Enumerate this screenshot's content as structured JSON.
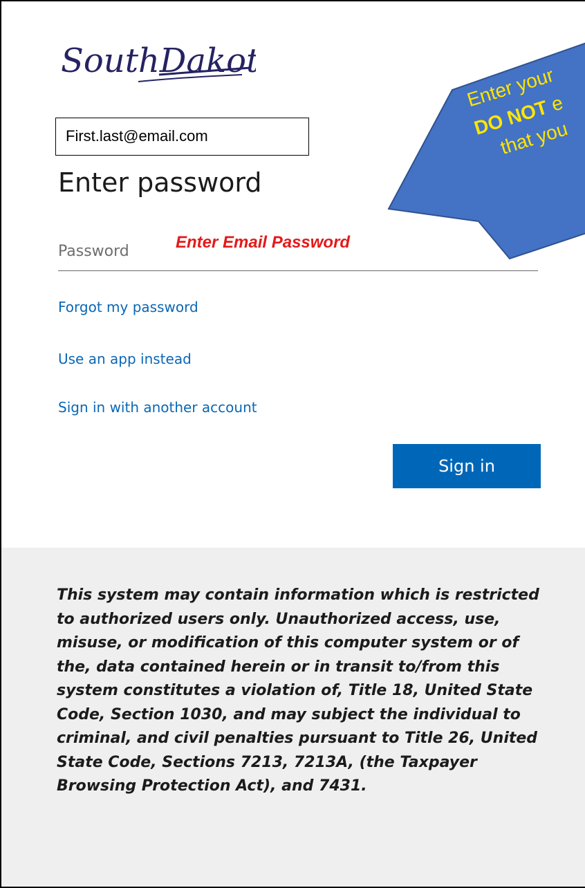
{
  "brand": {
    "logo_text": "SouthDakota",
    "logo_color": "#252362"
  },
  "account": {
    "email": "First.last@email.com"
  },
  "page": {
    "title": "Enter password"
  },
  "password_field": {
    "placeholder": "Password",
    "annotation": "Enter Email Password",
    "annotation_color": "#e31a1a"
  },
  "links": {
    "forgot": "Forgot my password",
    "use_app": "Use an app instead",
    "other_account": "Sign in with another account",
    "color": "#0a67b5"
  },
  "actions": {
    "sign_in_label": "Sign in",
    "button_color": "#0067b8"
  },
  "callout": {
    "line1": "Enter your",
    "line2_bold": "DO NOT",
    "line2_rest": " e",
    "line3": "that you",
    "fill_color": "#4472c4",
    "text_color": "#ffe600"
  },
  "notice": {
    "text": "This system may contain information which is restricted to authorized users only. Unauthorized access, use, misuse, or modification of this computer system or of the, data contained herein or in transit to/from this system constitutes a violation of, Title 18, United State Code, Section 1030, and may subject the individual to criminal, and civil penalties pursuant to Title 26, United State Code, Sections 7213, 7213A, (the Taxpayer Browsing Protection Act), and 7431."
  }
}
